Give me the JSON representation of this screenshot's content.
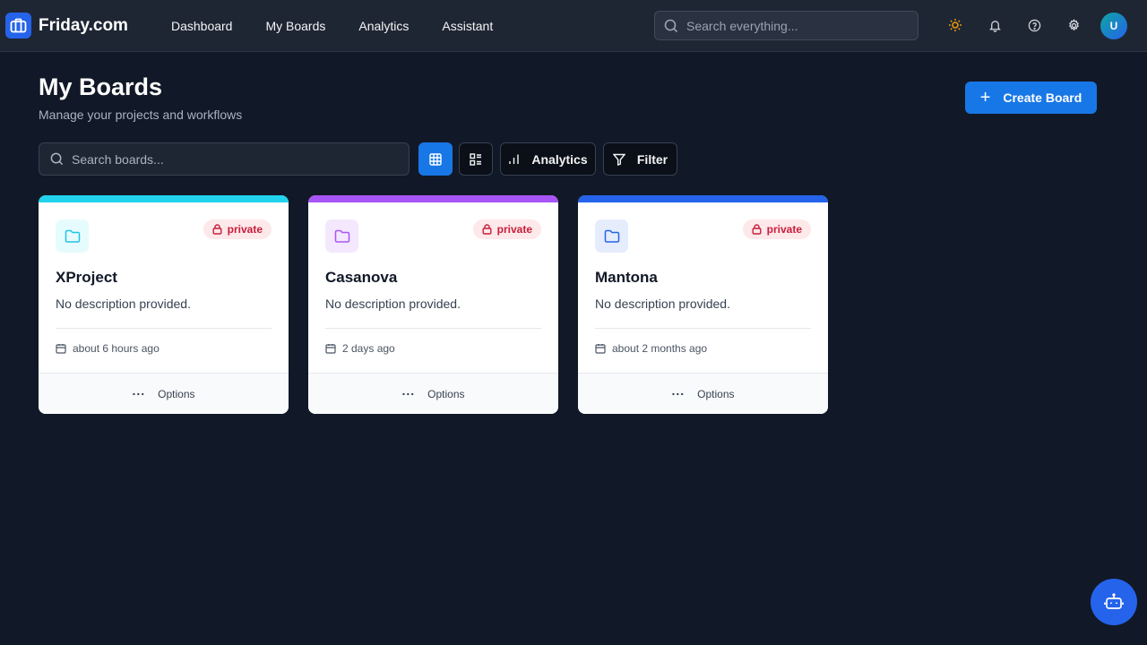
{
  "brand": {
    "name": "Friday.com",
    "color": "#2563eb"
  },
  "nav": {
    "items": [
      {
        "label": "Dashboard"
      },
      {
        "label": "My Boards"
      },
      {
        "label": "Analytics"
      },
      {
        "label": "Assistant"
      }
    ]
  },
  "header": {
    "search_placeholder": "Search everything...",
    "icons": [
      "sun-icon",
      "bell-icon",
      "help-icon",
      "gear-icon"
    ],
    "avatar_initial": "U"
  },
  "page": {
    "title": "My Boards",
    "subtitle": "Manage your projects and workflows",
    "create_label": "Create Board"
  },
  "toolbar": {
    "search_placeholder": "Search boards...",
    "analytics_label": "Analytics",
    "filter_label": "Filter",
    "active_view": "grid"
  },
  "boards": [
    {
      "name": "XProject",
      "description": "No description provided.",
      "visibility": "private",
      "updated": "about 6 hours ago",
      "options_label": "Options",
      "accent": "#22d3ee"
    },
    {
      "name": "Casanova",
      "description": "No description provided.",
      "visibility": "private",
      "updated": "2 days ago",
      "options_label": "Options",
      "accent": "#a855f7"
    },
    {
      "name": "Mantona",
      "description": "No description provided.",
      "visibility": "private",
      "updated": "about 2 months ago",
      "options_label": "Options",
      "accent": "#2563eb"
    }
  ],
  "colors": {
    "background": "#111827",
    "topbar": "#1f2633",
    "primary_button": "#1877e6",
    "private_badge_bg": "#fde8ea",
    "private_badge_text": "#c81e3a"
  }
}
